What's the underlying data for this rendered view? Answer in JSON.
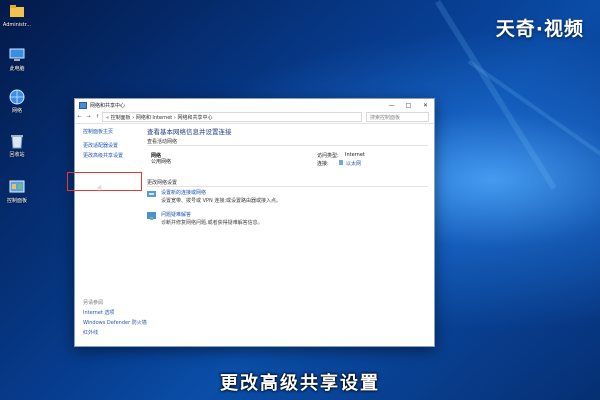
{
  "desktop": {
    "icons": [
      {
        "id": "user",
        "label": "Administr..."
      },
      {
        "id": "pc",
        "label": "此电脑"
      },
      {
        "id": "network",
        "label": "网络"
      },
      {
        "id": "recycle",
        "label": "回收站"
      },
      {
        "id": "control",
        "label": "控制面板"
      }
    ]
  },
  "watermark": "天奇·视频",
  "subtitle": "更改高级共享设置",
  "window": {
    "title": "网络和共享中心",
    "controls": {
      "minimize": "—",
      "maximize": "□",
      "close": "✕"
    },
    "address": {
      "back": "←",
      "forward": "→",
      "up": "↑",
      "path": "« 控制面板 › 网络和 Internet › 网络和共享中心",
      "search_placeholder": "搜索控制面板"
    },
    "left_pane": {
      "links": [
        "控制面板主页",
        "更改适配器设置",
        "更改高级共享设置"
      ],
      "see_also_title": "另请参阅",
      "see_also": [
        "Internet 选项",
        "Windows Defender 防火墙",
        "红外线"
      ]
    },
    "main": {
      "title": "查看基本网络信息并设置连接",
      "active_networks_header": "查看活动网络",
      "network_name": "网络",
      "network_type": "公用网络",
      "access_type_label": "访问类型:",
      "access_type_value": "Internet",
      "connections_label": "连接:",
      "connections_value": "以太网",
      "change_settings_header": "更改网络设置",
      "options": [
        {
          "link": "设置新的连接或网络",
          "desc": "设置宽带、拨号或 VPN 连接;或设置路由器或接入点。"
        },
        {
          "link": "问题疑难解答",
          "desc": "诊断并修复网络问题,或者获得疑难解答信息。"
        }
      ]
    }
  },
  "colors": {
    "accent": "#1d56b8",
    "highlight": "#e53935",
    "title_text": "#1e3f8a"
  }
}
